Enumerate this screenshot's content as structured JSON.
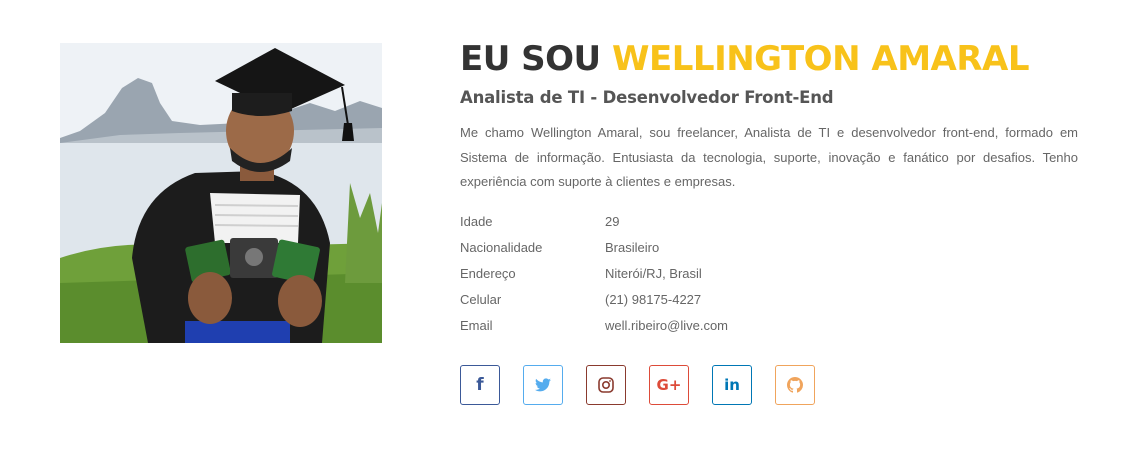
{
  "profile": {
    "headline_prefix": "EU SOU ",
    "headline_name": "WELLINGTON AMARAL",
    "subtitle": "Analista de TI - Desenvolvedor Front-End",
    "bio": "Me chamo Wellington Amaral, sou freelancer, Analista de TI e desenvolvedor front-end, formado em Sistema de informação. Entusiasta da tecnologia, suporte, inovação e fanático por desafios. Tenho experiência com suporte à clientes e empresas.",
    "accent_color": "#f8c21a"
  },
  "info": [
    {
      "label": "Idade",
      "value": "29"
    },
    {
      "label": "Nacionalidade",
      "value": "Brasileiro"
    },
    {
      "label": "Endereço",
      "value": "Niterói/RJ, Brasil"
    },
    {
      "label": "Celular",
      "value": "(21) 98175-4227"
    },
    {
      "label": "Email",
      "value": "well.ribeiro@live.com"
    }
  ],
  "socials": [
    {
      "icon": "facebook-icon",
      "glyph": "f",
      "color": "#3b5998"
    },
    {
      "icon": "twitter-icon",
      "glyph": "",
      "color": "#55acee"
    },
    {
      "icon": "instagram-icon",
      "glyph": "",
      "color": "#8a3a2e"
    },
    {
      "icon": "google-plus-icon",
      "glyph": "G+",
      "color": "#dd4b39"
    },
    {
      "icon": "linkedin-icon",
      "glyph": "in",
      "color": "#0077b5"
    },
    {
      "icon": "github-icon",
      "glyph": "",
      "color": "#f0a45c"
    }
  ]
}
